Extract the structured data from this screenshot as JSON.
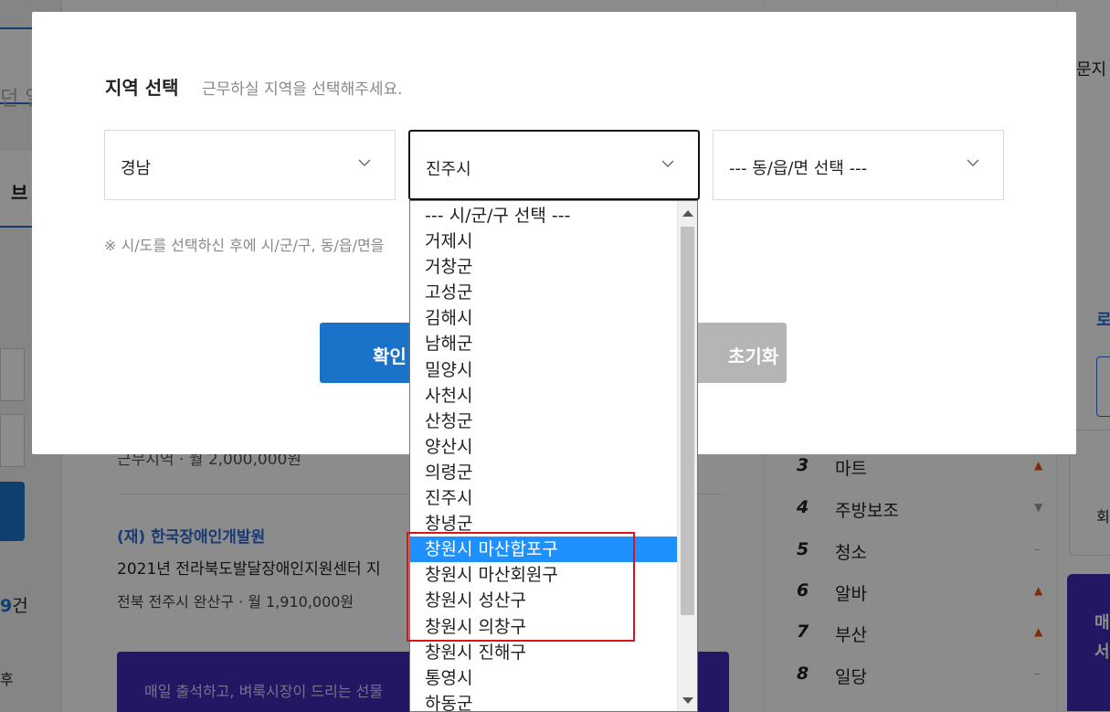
{
  "background": {
    "search_text": "던 일",
    "tab_label": "브",
    "count_number": "9",
    "count_suffix": "건",
    "after_label": "후",
    "job_row1": "근무지역 · 월 2,000,000원",
    "org": "(재) 한국장애인개발원",
    "job_title": "2021년 전라북도발달장애인지원센터 지",
    "job_location": "전북 전주시 완산구 · 월 1,910,000원",
    "banner_text": "매일 출석하고, 벼룩시장이 드리는 선물",
    "ranking": [
      {
        "num": "3",
        "label": "마트",
        "trend": "▲",
        "dir": "up"
      },
      {
        "num": "4",
        "label": "주방보조",
        "trend": "▼",
        "dir": "down"
      },
      {
        "num": "5",
        "label": "청소",
        "trend": "–",
        "dir": "flat"
      },
      {
        "num": "6",
        "label": "알바",
        "trend": "▲",
        "dir": "up"
      },
      {
        "num": "7",
        "label": "부산",
        "trend": "▲",
        "dir": "up"
      },
      {
        "num": "8",
        "label": "일당",
        "trend": "–",
        "dir": "flat"
      }
    ],
    "right_text1": "문지",
    "right_text2": "로",
    "right_text3": "회",
    "right_purple": "매\n서"
  },
  "modal": {
    "title": "지역 선택",
    "subtitle": "근무하실 지역을 선택해주세요.",
    "select_province": "경남",
    "select_city": "진주시",
    "select_dong": "--- 동/읍/면 선택 ---",
    "notice": "※ 시/도를 선택하신 후에 시/군/구, 동/읍/면을",
    "confirm_label": "확인",
    "reset_label": "초기화"
  },
  "dropdown": {
    "options": [
      "--- 시/군/구 선택 ---",
      "거제시",
      "거창군",
      "고성군",
      "김해시",
      "남해군",
      "밀양시",
      "사천시",
      "산청군",
      "양산시",
      "의령군",
      "진주시",
      "창녕군",
      "창원시 마산합포구",
      "창원시 마산회원구",
      "창원시 성산구",
      "창원시 의창구",
      "창원시 진해구",
      "통영시",
      "하동군"
    ],
    "highlighted": "창원시 마산합포구"
  },
  "colors": {
    "accent": "#1a73c9",
    "selection": "#1e90ff",
    "annotation": "#d9141a"
  }
}
